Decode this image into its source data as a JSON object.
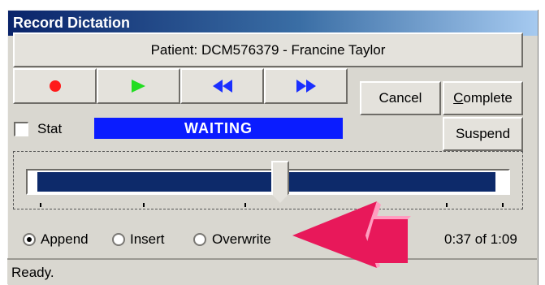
{
  "window": {
    "title": "Record Dictation"
  },
  "patient": {
    "label": "Patient: DCM576379 - Francine Taylor"
  },
  "transport": [
    {
      "name": "record",
      "icon": "record-icon"
    },
    {
      "name": "play",
      "icon": "play-icon"
    },
    {
      "name": "rewind",
      "icon": "rewind-icon"
    },
    {
      "name": "fast-forward",
      "icon": "fast-forward-icon"
    }
  ],
  "buttons": {
    "cancel": "Cancel",
    "complete": "Complete",
    "suspend": "Suspend"
  },
  "stat": {
    "label": "Stat",
    "checked": false
  },
  "status_bar_text": "WAITING",
  "position": {
    "fraction": 0.53
  },
  "modes": {
    "options": [
      "Append",
      "Insert",
      "Overwrite"
    ],
    "selected": "Append"
  },
  "time": {
    "display": "0:37 of 1:09"
  },
  "footer": {
    "status": "Ready."
  },
  "colors": {
    "waiting_bg": "#0a1cff",
    "progress": "#0d2a6a",
    "arrow": "#e8185a"
  }
}
